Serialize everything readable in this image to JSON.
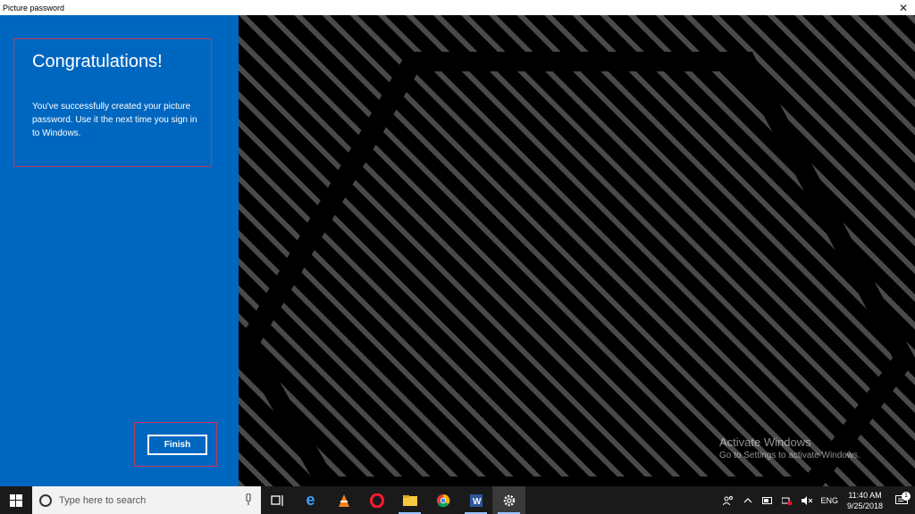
{
  "window": {
    "title": "Picture password",
    "close_glyph": "✕"
  },
  "panel": {
    "heading": "Congratulations!",
    "message": "You've successfully created your picture password. Use it the next time you sign in to Windows.",
    "finish_label": "Finish"
  },
  "watermark": {
    "line1": "Activate Windows",
    "line2": "Go to Settings to activate Windows."
  },
  "taskbar": {
    "search_placeholder": "Type here to search",
    "apps": [
      "task-view",
      "edge",
      "vlc",
      "opera",
      "file-explorer",
      "chrome",
      "word",
      "settings"
    ],
    "language": "ENG",
    "time": "11:40 AM",
    "date": "9/25/2018",
    "notification_count": "1"
  },
  "colors": {
    "accent": "#0067c0",
    "highlight_border": "#c0395a"
  }
}
